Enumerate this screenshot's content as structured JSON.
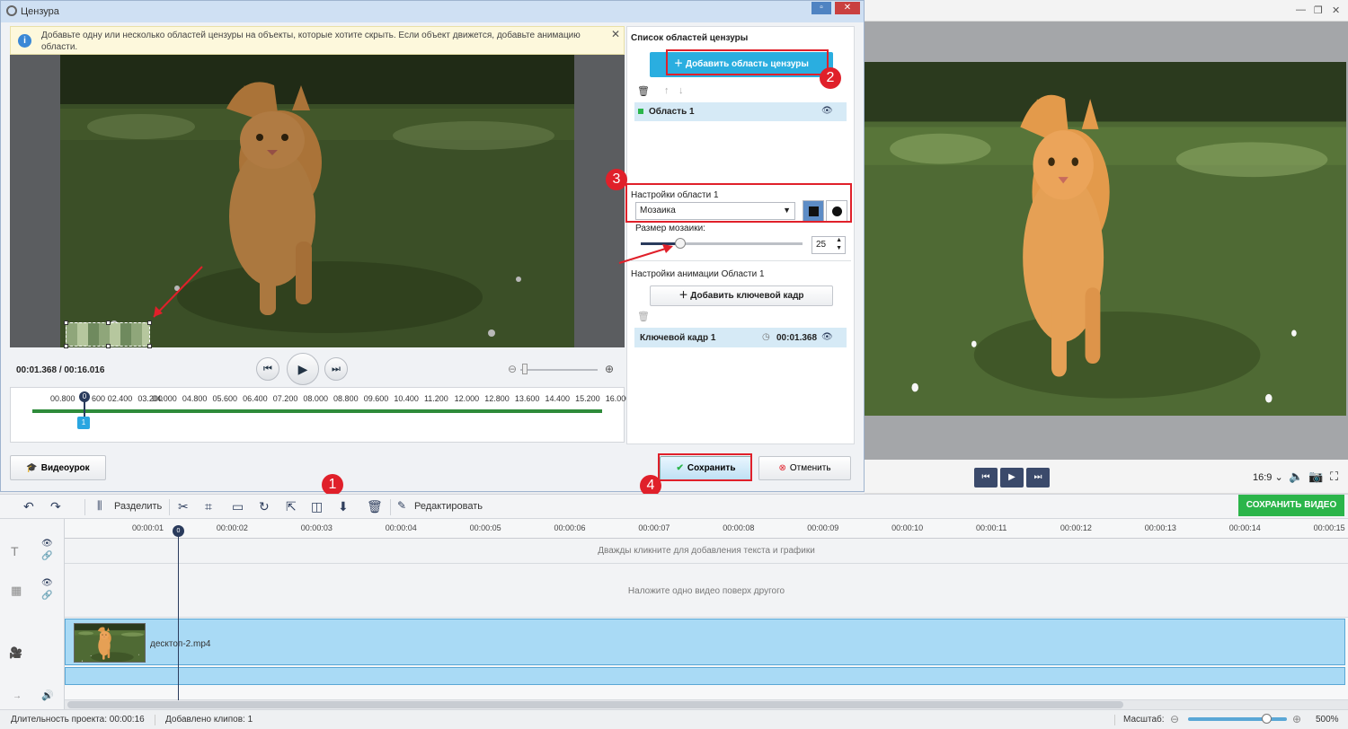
{
  "dialog": {
    "title": "Цензура",
    "info_text": "Добавьте одну или несколько областей цензуры на объекты, которые хотите скрыть. Если объект движется, добавьте анимацию области.",
    "time_readout": "00:01.368 / 00:16.016",
    "timeline_ticks": [
      "00.800",
      "0",
      "600",
      "02.400",
      "03.200",
      "04.000",
      "04.800",
      "05.600",
      "06.400",
      "07.200",
      "08.000",
      "08.800",
      "09.600",
      "10.400",
      "11.200",
      "12.000",
      "12.800",
      "13.600",
      "14.400",
      "15.200",
      "16.000"
    ],
    "playhead_label": "0",
    "keyframe_marker": "1",
    "video_lesson_label": "Видеоурок",
    "save_label": "Сохранить",
    "cancel_label": "Отменить",
    "right_panel": {
      "list_title": "Список областей цензуры",
      "add_area_label": "Добавить область цензуры",
      "area_name": "Область 1",
      "settings_title": "Настройки области 1",
      "mode_value": "Мозаика",
      "mosaic_size_label": "Размер мозаики:",
      "mosaic_size_value": "25",
      "mosaic_slider_level": 0.24,
      "animation_title": "Настройки анимации Области 1",
      "add_keyframe_label": "Добавить ключевой кадр",
      "keyframe_name": "Ключевой кадр 1",
      "keyframe_time": "00:01.368"
    }
  },
  "annotations": [
    "1",
    "2",
    "3",
    "4"
  ],
  "preview": {
    "aspect_ratio": "16:9"
  },
  "toolbar": {
    "split_label": "Разделить",
    "edit_label": "Редактировать",
    "export_label": "СОХРАНИТЬ ВИДЕО"
  },
  "timeline": {
    "ruler": [
      "00:00:01",
      "00:00:02",
      "00:00:03",
      "00:00:04",
      "00:00:05",
      "00:00:06",
      "00:00:07",
      "00:00:08",
      "00:00:09",
      "00:00:10",
      "00:00:11",
      "00:00:12",
      "00:00:13",
      "00:00:14",
      "00:00:15"
    ],
    "playhead_label": "0",
    "text_track_hint": "Дважды кликните для добавления текста и графики",
    "overlay_track_hint": "Наложите одно видео поверх другого",
    "clip_name": "десктоп-2.mp4"
  },
  "status": {
    "duration": "Длительность проекта:  00:00:16",
    "clips": "Добавлено клипов: 1",
    "zoom_label": "Масштаб:",
    "zoom_value": "500%"
  },
  "colors": {
    "accent_blue": "#2aaee0",
    "export_green": "#2bb54a",
    "annotation_red": "#e0202a",
    "clip_blue": "#a9daf5"
  }
}
